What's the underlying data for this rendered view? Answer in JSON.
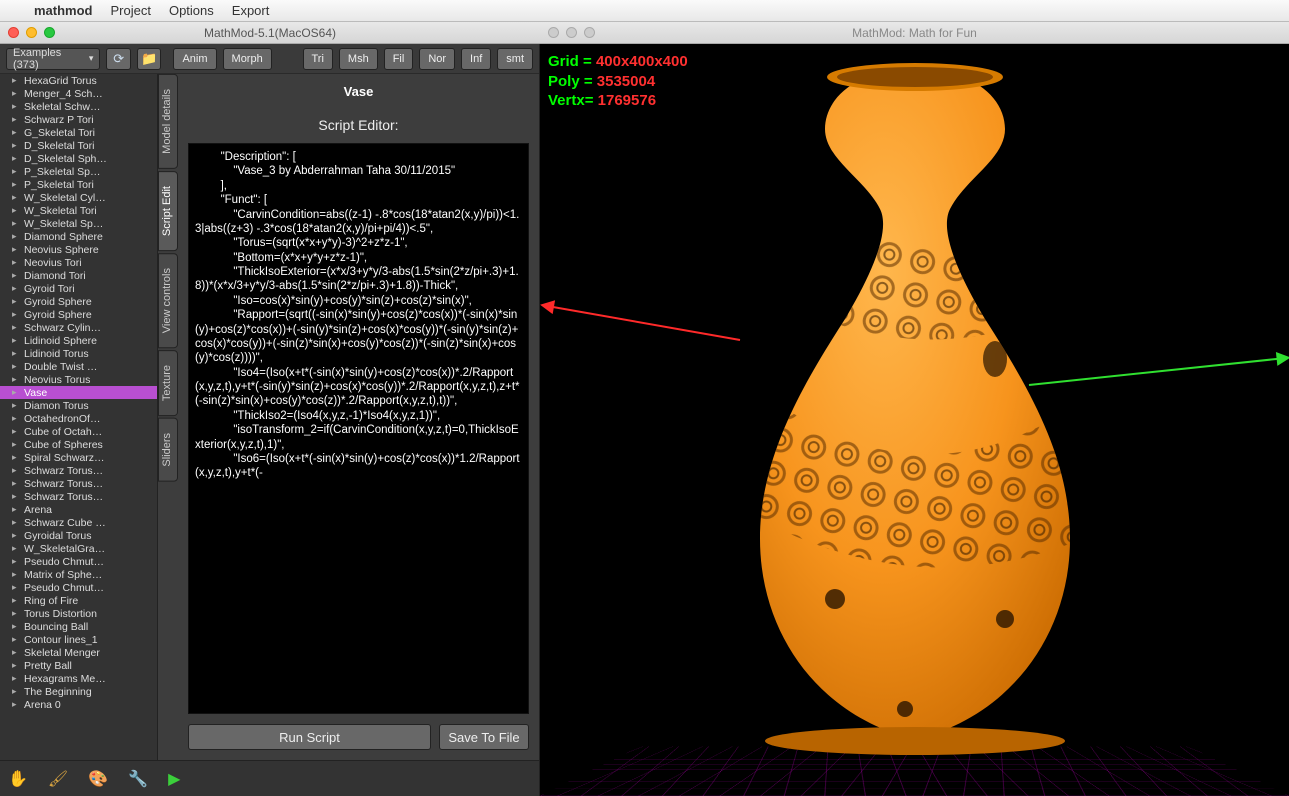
{
  "menubar": {
    "app": "mathmod",
    "items": [
      "Project",
      "Options",
      "Export"
    ]
  },
  "windows": {
    "left_title": "MathMod-5.1(MacOS64)",
    "right_title": "MathMod: Math for Fun"
  },
  "toolbar": {
    "examples_label": "Examples (373)",
    "buttons": {
      "anim": "Anim",
      "morph": "Morph",
      "tri": "Tri",
      "msh": "Msh",
      "fil": "Fil",
      "nor": "Nor",
      "inf": "Inf",
      "smt": "smt"
    }
  },
  "model_title": "Vase",
  "tree_selected": "Vase",
  "tree": [
    "HexaGrid Torus",
    "Menger_4 Sch…",
    "Skeletal Schw…",
    "Schwarz P Tori",
    "G_Skeletal Tori",
    "D_Skeletal Tori",
    "D_Skeletal Sph…",
    "P_Skeletal Sp…",
    "P_Skeletal Tori",
    "W_Skeletal Cyl…",
    "W_Skeletal Tori",
    "W_Skeletal Sp…",
    "Diamond Sphere",
    "Neovius Sphere",
    "Neovius Tori",
    "Diamond Tori",
    "Gyroid Tori",
    "Gyroid Sphere",
    "Gyroid Sphere",
    "Schwarz Cylin…",
    "Lidinoid Sphere",
    "Lidinoid Torus",
    "Double Twist …",
    "Neovius Torus",
    "Vase",
    "Diamon Torus",
    "OctahedronOf…",
    "Cube of Octah…",
    "Cube of Spheres",
    "Spiral Schwarz…",
    "Schwarz Torus…",
    "Schwarz Torus…",
    "Schwarz Torus…",
    "Arena",
    "Schwarz Cube …",
    "Gyroidal Torus",
    "W_SkeletalGra…",
    "Pseudo Chmut…",
    "Matrix of Sphe…",
    "Pseudo Chmut…",
    "Ring of Fire",
    "Torus Distortion",
    "Bouncing Ball",
    "Contour lines_1",
    "Skeletal Menger",
    "Pretty Ball",
    "Hexagrams Me…",
    "The Beginning",
    "Arena 0"
  ],
  "vtabs": [
    "Model details",
    "Script Edit",
    "View controls",
    "Texture",
    "Sliders"
  ],
  "vtab_active": 1,
  "editor": {
    "label": "Script Editor:",
    "run": "Run Script",
    "save": "Save To File",
    "content": "        \"Description\": [\n            \"Vase_3 by Abderrahman Taha 30/11/2015\"\n        ],\n        \"Funct\": [\n            \"CarvinCondition=abs((z-1) -.8*cos(18*atan2(x,y)/pi))<1.3|abs((z+3) -.3*cos(18*atan2(x,y)/pi+pi/4))<.5\",\n            \"Torus=(sqrt(x*x+y*y)-3)^2+z*z-1\",\n            \"Bottom=(x*x+y*y+z*z-1)\",\n            \"ThickIsoExterior=(x*x/3+y*y/3-abs(1.5*sin(2*z/pi+.3)+1.8))*(x*x/3+y*y/3-abs(1.5*sin(2*z/pi+.3)+1.8))-Thick\",\n            \"Iso=cos(x)*sin(y)+cos(y)*sin(z)+cos(z)*sin(x)\",\n            \"Rapport=(sqrt((-sin(x)*sin(y)+cos(z)*cos(x))*(-sin(x)*sin(y)+cos(z)*cos(x))+(-sin(y)*sin(z)+cos(x)*cos(y))*(-sin(y)*sin(z)+cos(x)*cos(y))+(-sin(z)*sin(x)+cos(y)*cos(z))*(-sin(z)*sin(x)+cos(y)*cos(z))))\",\n            \"Iso4=(Iso(x+t*(-sin(x)*sin(y)+cos(z)*cos(x))*.2/Rapport(x,y,z,t),y+t*(-sin(y)*sin(z)+cos(x)*cos(y))*.2/Rapport(x,y,z,t),z+t*(-sin(z)*sin(x)+cos(y)*cos(z))*.2/Rapport(x,y,z,t),t))\",\n            \"ThickIso2=(Iso4(x,y,z,-1)*Iso4(x,y,z,1))\",\n            \"isoTransform_2=if(CarvinCondition(x,y,z,t)=0,ThickIsoExterior(x,y,z,t),1)\",\n            \"Iso6=(Iso(x+t*(-sin(x)*sin(y)+cos(z)*cos(x))*1.2/Rapport(x,y,z,t),y+t*(-"
  },
  "stats": {
    "grid_label": "Grid =",
    "grid_value": "400x400x400",
    "poly_label": "Poly =",
    "poly_value": "3535004",
    "vert_label": "Vertx=",
    "vert_value": "1769576"
  }
}
